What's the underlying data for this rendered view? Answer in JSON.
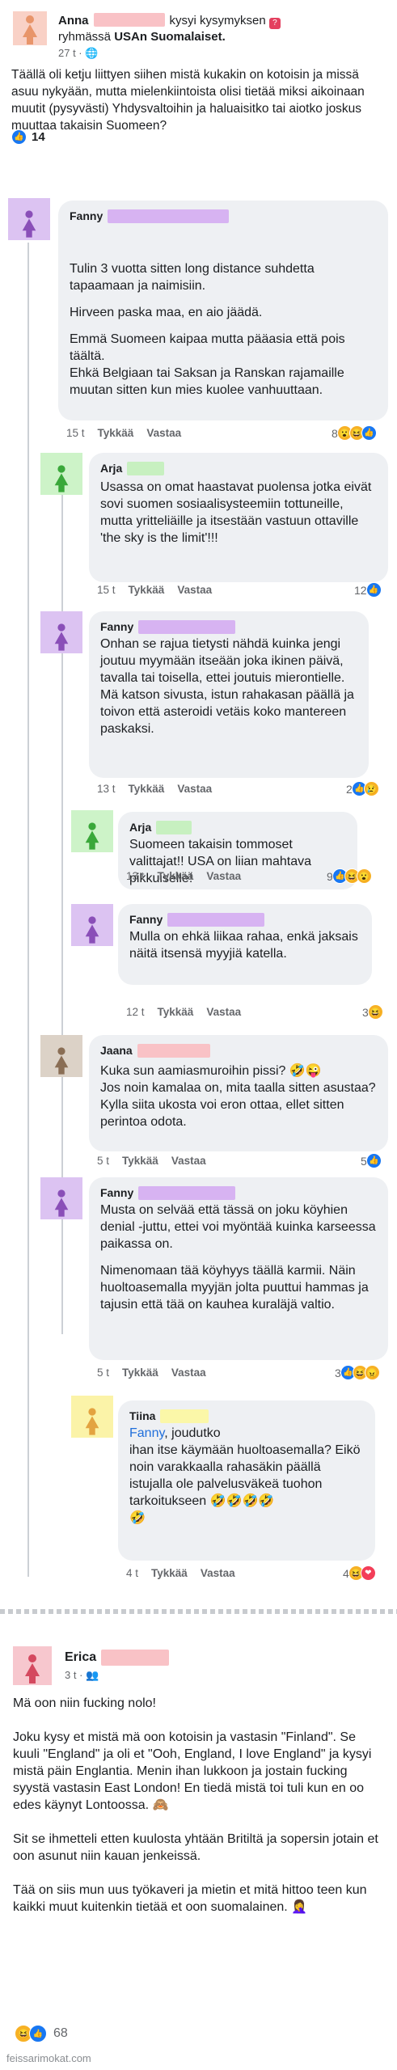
{
  "post": {
    "author": "Anna",
    "action": "kysyi kysymyksen",
    "group_prefix": "ryhmässä",
    "group": "USAn Suomalaiset.",
    "time": "27 t",
    "body": "Täällä oli ketju liittyen siihen mistä kukakin on kotoisin ja missä asuu nykyään, mutta mielenkiintoista olisi tietää miksi aikoinaan muutit (pysyvästi) Yhdysvaltoihin ja haluaisitko tai aiotko joskus muuttaa takaisin Suomeen?",
    "reaction_count": "14"
  },
  "labels": {
    "like": "Tykkää",
    "reply": "Vastaa"
  },
  "comments": [
    {
      "name": "Fanny",
      "time": "15 t",
      "count": "8",
      "text": [
        "Tulin 3 vuotta sitten long distance suhdetta tapaamaan ja naimisiin.",
        "Hirveen paska maa, en aio jäädä.",
        "Emmä Suomeen kaipaa mutta pääasia että pois täältä.\nEhkä Belgiaan tai Saksan ja Ranskan rajamaille muutan sitten kun mies kuolee vanhuuttaan."
      ]
    },
    {
      "name": "Arja",
      "time": "15 t",
      "count": "12",
      "text": [
        "Usassa on omat haastavat puolensa jotka eivät sovi suomen sosiaalisysteemiin tottuneille, mutta yritteliäille ja itsestään vastuun ottaville 'the sky is the limit'!!!"
      ]
    },
    {
      "name": "Fanny",
      "time": "13 t",
      "count": "2",
      "text": [
        "Onhan se rajua tietysti nähdä kuinka jengi joutuu myymään itseään joka ikinen päivä, tavalla tai toisella, ettei joutuis mierontielle.\nMä katson sivusta, istun rahakasan päällä ja toivon että asteroidi vetäis koko mantereen paskaksi."
      ]
    },
    {
      "name": "Arja",
      "time": "13 t",
      "count": "9",
      "text": [
        "Suomeen takaisin tommoset valittajat!! USA on liian mahtava pikkuiselle!"
      ]
    },
    {
      "name": "Fanny",
      "time": "12 t",
      "count": "3",
      "text": [
        "Mulla on ehkä liikaa rahaa, enkä jaksais näitä itsensä myyjiä katella."
      ]
    },
    {
      "name": "Jaana",
      "time": "5 t",
      "count": "5",
      "text": [
        "Kuka sun aamiasmuroihin pissi? 🤣😜\nJos noin kamalaa on, mita taalla sitten asustaa? Kylla siita ukosta voi eron ottaa, ellet sitten perintoa odota."
      ]
    },
    {
      "name": "Fanny",
      "time": "5 t",
      "count": "3",
      "text": [
        "Musta on selvää että tässä on joku köyhien denial -juttu, ettei voi myöntää kuinka karseessa paikassa on.",
        "Nimenomaan tää köyhyys täällä karmii. Näin huoltoasemalla myyjän jolta puuttui hammas ja tajusin että tää on kauhea kuraläjä valtio."
      ]
    },
    {
      "name": "Tiina",
      "time": "4 t",
      "count": "4",
      "mention": "Fanny",
      "text": [
        ", joudutko\nihan itse käymään huoltoasemalla? Eikö noin varakkaalla rahasäkin päällä istujalla ole palvelusväkeä tuohon tarkoitukseen 🤣🤣🤣🤣\n🤣"
      ]
    }
  ],
  "post2": {
    "author": "Erica",
    "time": "3 t",
    "paragraphs": [
      "Mä oon niin fucking nolo!",
      "Joku kysy et mistä mä oon kotoisin ja vastasin \"Finland\". Se kuuli \"England\" ja oli et \"Ooh, England, I love England\" ja kysyi mistä päin Englantia. Menin ihan lukkoon ja jostain fucking syystä vastasin East London! En tiedä mistä toi tuli kun en oo edes käynyt Lontoossa. 🙈",
      "Sit se ihmetteli etten kuulosta yhtään Britiltä ja sopersin jotain et oon asunut niin kauan jenkeissä.",
      "Tää on siis mun uus työkaveri ja mietin et mitä hittoo teen kun kaikki muut kuitenkin tietää et oon suomalainen. 🤦‍♀️"
    ],
    "reaction_count": "68"
  },
  "watermark": "feissarimokat.com",
  "colors": {
    "accent": "#216fdb",
    "like": "#1877f2",
    "name_blur_purple": "#d7b3f2",
    "name_blur_pink": "#f9c2c6",
    "name_blur_green": "#c7f0c0",
    "name_blur_yellow": "#fbf7a8"
  }
}
